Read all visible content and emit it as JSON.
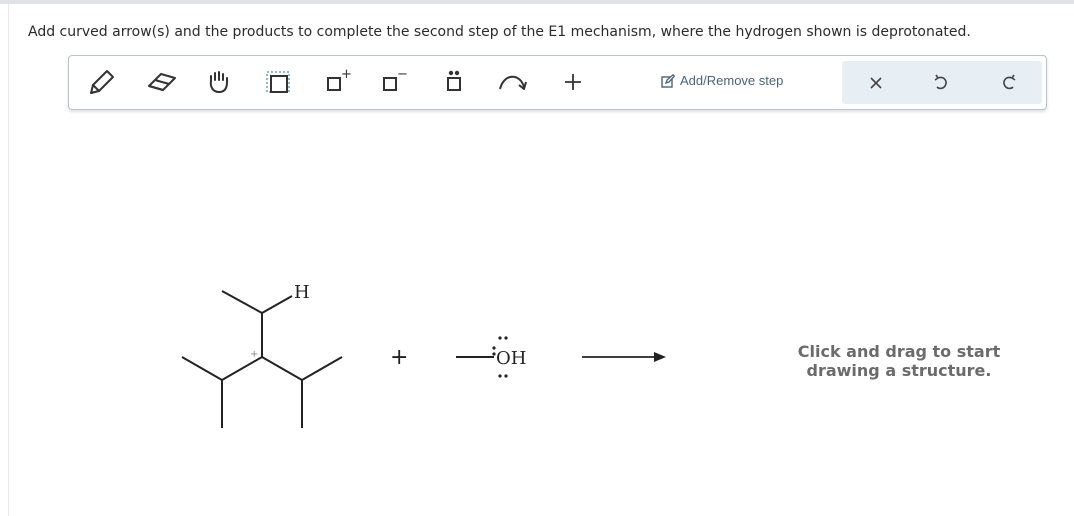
{
  "question": {
    "text": "Add curved arrow(s) and the products to complete the second step of the E1 mechanism, where the hydrogen shown is deprotonated."
  },
  "toolbar": {
    "tools": [
      {
        "name": "pencil-icon"
      },
      {
        "name": "eraser-icon"
      },
      {
        "name": "hand-icon"
      },
      {
        "name": "select-box-icon"
      },
      {
        "name": "positive-charge-icon",
        "superscript": "+"
      },
      {
        "name": "negative-charge-icon",
        "superscript": "−"
      },
      {
        "name": "lone-pair-icon"
      },
      {
        "name": "curved-arrow-icon"
      },
      {
        "name": "plus-icon",
        "label": "+"
      }
    ],
    "add_remove_label": "Add/Remove step",
    "clear_label": "×",
    "undo_name": "undo-icon",
    "redo_name": "redo-icon"
  },
  "reaction": {
    "h_label": "H",
    "charge_label": "+",
    "plus_label": "+",
    "hydroxide_label": "OH"
  },
  "canvas": {
    "hint_line1": "Click and drag to start",
    "hint_line2": "drawing a structure."
  },
  "colors": {
    "accent": "#4a6477",
    "toolbar_border": "#b9c3cc",
    "right_group_bg": "#e7eef4"
  }
}
